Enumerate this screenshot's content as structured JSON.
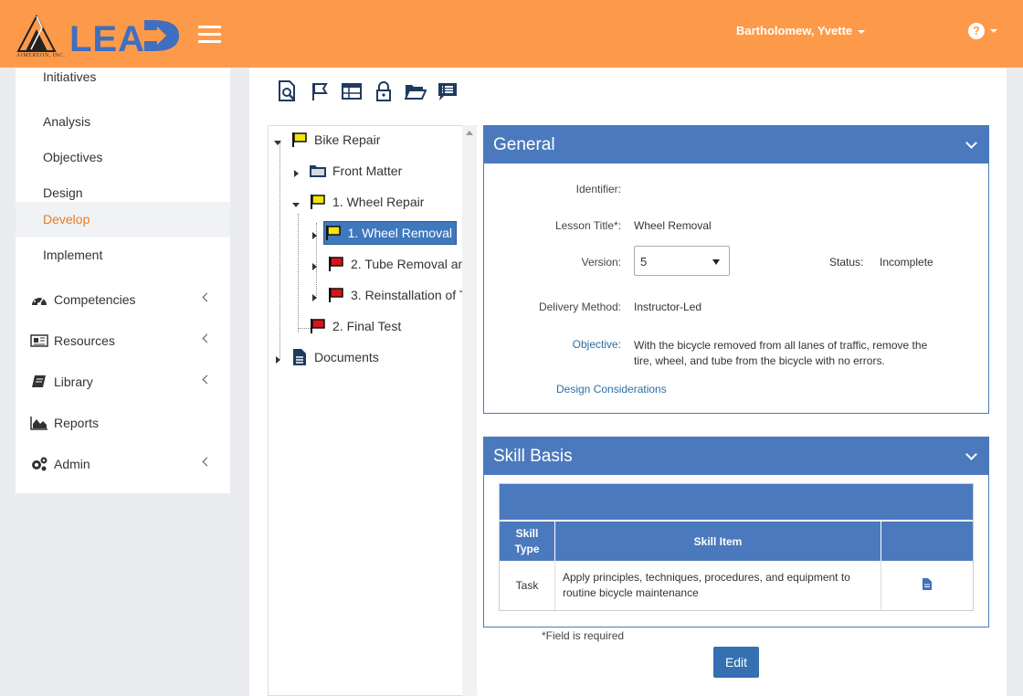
{
  "header": {
    "logo_text": "LEAD",
    "logo_subtext": "AIMEREON, INC.",
    "user_name": "Bartholomew, Yvette",
    "help_glyph": "?"
  },
  "sidebar": {
    "sub_items": [
      {
        "label": "Initiatives",
        "active": false
      },
      {
        "label": "Analysis",
        "active": false
      },
      {
        "label": "Objectives",
        "active": false
      },
      {
        "label": "Design",
        "active": false
      },
      {
        "label": "Develop",
        "active": true
      },
      {
        "label": "Implement",
        "active": false
      }
    ],
    "main_items": [
      {
        "label": "Competencies",
        "icon": "dashboard-icon",
        "has_children": true
      },
      {
        "label": "Resources",
        "icon": "newspaper-icon",
        "has_children": true
      },
      {
        "label": "Library",
        "icon": "book-icon",
        "has_children": true
      },
      {
        "label": "Reports",
        "icon": "area-chart-icon",
        "has_children": false
      },
      {
        "label": "Admin",
        "icon": "cogs-icon",
        "has_children": true
      }
    ]
  },
  "toolbar": [
    "search-document-icon",
    "flag-icon",
    "table-icon",
    "lock-icon",
    "folder-open-icon",
    "comment-list-icon"
  ],
  "tree": {
    "nodes": [
      {
        "label": "Bike Repair",
        "icon": "yellow-flag-icon"
      },
      {
        "label": "Front Matter",
        "icon": "folder-icon"
      },
      {
        "label": "1. Wheel Repair",
        "icon": "yellow-flag-icon"
      },
      {
        "label": "1. Wheel Removal",
        "icon": "yellow-flag-icon",
        "selected": true
      },
      {
        "label": "2. Tube Removal an",
        "icon": "red-flag-icon"
      },
      {
        "label": "3. Reinstallation of T",
        "icon": "red-flag-icon"
      },
      {
        "label": "2. Final Test",
        "icon": "red-flag-icon"
      },
      {
        "label": "Documents",
        "icon": "document-icon"
      }
    ]
  },
  "general": {
    "title": "General",
    "identifier_label": "Identifier:",
    "identifier_value": "",
    "lesson_title_label": "Lesson Title*:",
    "lesson_title_value": "Wheel Removal",
    "version_label": "Version:",
    "version_value": "5",
    "status_label": "Status:",
    "status_value": "Incomplete",
    "delivery_label": "Delivery Method:",
    "delivery_value": "Instructor-Led",
    "objective_label": "Objective:",
    "objective_line1": "With the bicycle removed from all lanes of traffic, remove the",
    "objective_line2": "tire, wheel, and tube from the bicycle with no errors.",
    "design_link": "Design Considerations"
  },
  "skill_basis": {
    "title": "Skill Basis",
    "col_type_line1": "Skill",
    "col_type_line2": "Type",
    "col_item": "Skill Item",
    "rows": [
      {
        "type": "Task",
        "item_line1": "Apply principles, techniques, procedures, and equipment to",
        "item_line2": "routine bicycle maintenance"
      }
    ]
  },
  "footer": {
    "required_note": "*Field is required",
    "edit_label": "Edit"
  },
  "colors": {
    "header": "#fd9a4a",
    "accent_blue": "#4b79bd",
    "logo_blue": "#3f6fc0",
    "active_nav": "#e67e22",
    "flag_yellow": "#f2e60b",
    "flag_red": "#d8141b"
  }
}
